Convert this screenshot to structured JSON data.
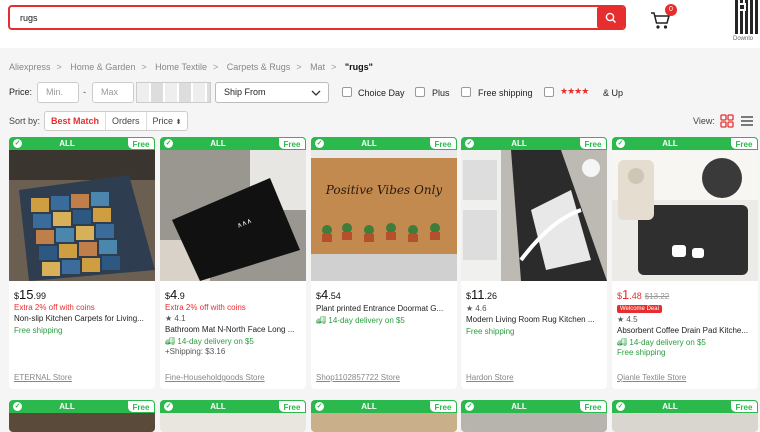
{
  "search": {
    "value": "rugs"
  },
  "cart": {
    "count": "0"
  },
  "header": {
    "download_label": "Downlo"
  },
  "breadcrumb": [
    "Aliexpress",
    "Home & Garden",
    "Home Textile",
    "Carpets & Rugs",
    "Mat",
    "\"rugs\""
  ],
  "filters": {
    "price_label": "Price:",
    "min_placeholder": "Min.",
    "max_placeholder": "Max",
    "dash": "-",
    "ship_from": "Ship From",
    "choice_day": "Choice Day",
    "plus": "Plus",
    "free_shipping": "Free shipping",
    "stars": "★★★★",
    "and_up": "& Up"
  },
  "sort": {
    "label": "Sort by:",
    "options": [
      "Best Match",
      "Orders",
      "Price"
    ],
    "view_label": "View:"
  },
  "badges": {
    "all": "ALL",
    "free": "Free"
  },
  "colors": {
    "accent": "#e62e2e",
    "green": "#2bb84c"
  },
  "products": [
    {
      "price_symbol": "$",
      "price_main": "15",
      "price_dec": ".99",
      "coins": "Extra 2% off with coins",
      "title": "Non-slip Kitchen Carpets for Living...",
      "rating": "",
      "delivery": "",
      "free_shipping": "Free shipping",
      "shipping_extra": "",
      "store": "ETERNAL Store"
    },
    {
      "price_symbol": "$",
      "price_main": "4",
      "price_dec": ".9",
      "coins": "Extra 2% off with coins",
      "title": "Bathroom Mat N-North Face Long ...",
      "rating": "★ 4.1",
      "delivery": "14-day delivery on $5",
      "free_shipping": "",
      "shipping_extra": "+Shipping: $3.16",
      "store": "Fine-Householdgoods Store"
    },
    {
      "price_symbol": "$",
      "price_main": "4",
      "price_dec": ".54",
      "coins": "",
      "title": "Plant printed Entrance Doormat G...",
      "rating": "",
      "delivery": "14-day delivery on $5",
      "free_shipping": "",
      "shipping_extra": "",
      "store": "Shop1102857722 Store"
    },
    {
      "price_symbol": "$",
      "price_main": "11",
      "price_dec": ".26",
      "coins": "",
      "title": "Modern Living Room Rug Kitchen ...",
      "rating": "★ 4.6",
      "delivery": "",
      "free_shipping": "Free shipping",
      "shipping_extra": "",
      "store": "Hardon Store"
    },
    {
      "price_symbol": "$",
      "price_main": "1",
      "price_dec": ".48",
      "price_old": "$13.22",
      "welcome": "Welcome Deal",
      "coins": "",
      "title": "Absorbent Coffee Drain Pad Kitche...",
      "rating": "★ 4.5",
      "delivery": "14-day delivery on $5",
      "free_shipping": "Free shipping",
      "shipping_extra": "",
      "store": "Qianle Textile Store"
    }
  ],
  "doormat_text": "Positive Vibes Only"
}
